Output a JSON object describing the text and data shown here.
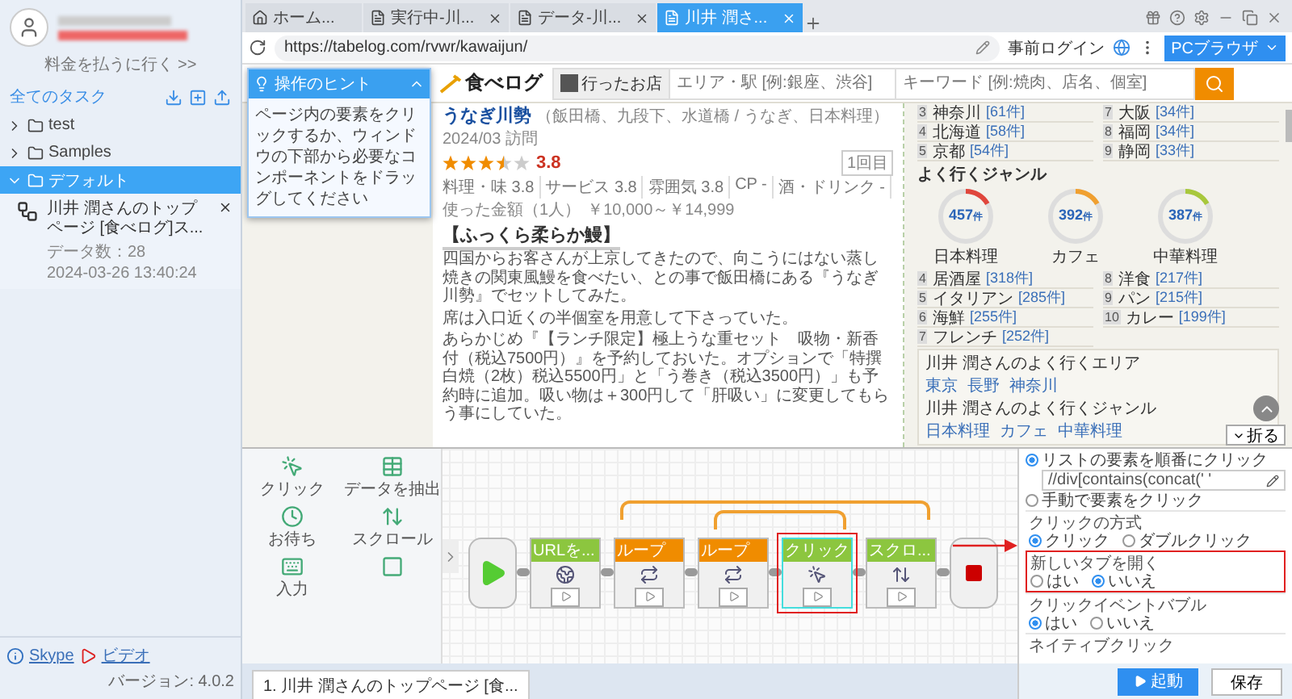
{
  "sidebar": {
    "billing_link": "料金を払うに行く >>",
    "tasks_title": "全てのタスク",
    "folders": [
      {
        "name": "test",
        "expanded": false,
        "selected": false
      },
      {
        "name": "Samples",
        "expanded": false,
        "selected": false
      },
      {
        "name": "デフォルト",
        "expanded": true,
        "selected": true,
        "tasks": [
          {
            "title": "川井 潤さんのトップページ [食べログ]ス...",
            "data_count": "データ数：28",
            "date": "2024-03-26 13:40:24"
          }
        ]
      }
    ],
    "footer": {
      "skype": "Skype",
      "video": "ビデオ",
      "version": "バージョン: 4.0.2"
    }
  },
  "browser": {
    "tabs": [
      {
        "label": "ホーム...",
        "kind": "home",
        "selected": false
      },
      {
        "label": "実行中-川...",
        "kind": "page",
        "selected": false
      },
      {
        "label": "データ-川...",
        "kind": "page",
        "selected": false
      },
      {
        "label": "川井 潤さ...",
        "kind": "page",
        "selected": true
      }
    ],
    "url": "https://tabelog.com/rvwr/kawaijun/",
    "login": "事前ログイン",
    "mode_button": "PCブラウザ"
  },
  "hint": {
    "title": "操作のヒント",
    "text": "ページ内の要素をクリックするか、ウィンドウの下部から必要なコンポーネントをドラッグしてください"
  },
  "page": {
    "logo": "食べログ",
    "went_label": "行ったお店",
    "area_placeholder": "エリア・駅 [例:銀座、渋谷]",
    "keyword_placeholder": "キーワード [例:焼肉、店名、個室]",
    "review": {
      "restaurant": "うなぎ川勢",
      "restaurant_info": "（飯田橋、九段下、水道橋 / うなぎ、日本料理）",
      "visit": "2024/03 訪問",
      "stars": 3.5,
      "score": "3.8",
      "subscores": [
        {
          "label": "料理・味",
          "value": "3.8"
        },
        {
          "label": "サービス",
          "value": "3.8"
        },
        {
          "label": "雰囲気",
          "value": "3.8"
        },
        {
          "label": "CP",
          "value": "-"
        },
        {
          "label": "酒・ドリンク",
          "value": "-"
        }
      ],
      "visit_count": "1回目",
      "price_label": "使った金額（1人）",
      "price": "￥10,000～￥14,999",
      "title": "【ふっくら柔らか鰻】",
      "paragraphs": [
        "四国からお客さんが上京してきたので、向こうにはない蒸し焼きの関東風鰻を食べたい、との事で飯田橋にある『うなぎ川勢』でセットしてみた。",
        "席は入口近くの半個室を用意して下さっていた。",
        "あらかじめ『【ランチ限定】極上うな重セット　吸物・新香付（税込7500円）』を予約しておいた。オプションで「特撰白焼（2枚）税込5500円」と「う巻き（税込3500円）」も予約時に追加。吸い物は＋300円して「肝吸い」に変更してもらう事にしていた。"
      ]
    },
    "areas": [
      {
        "rank": "3",
        "name": "神奈川",
        "count": "[61件]"
      },
      {
        "rank": "7",
        "name": "大阪",
        "count": "[34件]"
      },
      {
        "rank": "4",
        "name": "北海道",
        "count": "[58件]"
      },
      {
        "rank": "8",
        "name": "福岡",
        "count": "[34件]"
      },
      {
        "rank": "5",
        "name": "京都",
        "count": "[54件]"
      },
      {
        "rank": "9",
        "name": "静岡",
        "count": "[33件]"
      }
    ],
    "genre_title": "よく行くジャンル",
    "top_genres": [
      {
        "count": "457$_{件}$",
        "name": "日本料理",
        "color": "#e0463c"
      },
      {
        "count": "392$_{件}$",
        "name": "カフェ",
        "color": "#f0a030"
      },
      {
        "count": "387$_{件}$",
        "name": "中華料理",
        "color": "#a8c83c"
      }
    ],
    "genres": [
      {
        "rank": "4",
        "name": "居酒屋",
        "count": "[318件]"
      },
      {
        "rank": "5",
        "name": "イタリアン",
        "count": "[285件]"
      },
      {
        "rank": "6",
        "name": "海鮮",
        "count": "[255件]"
      },
      {
        "rank": "7",
        "name": "フレンチ",
        "count": "[252件]"
      },
      {
        "rank": "8",
        "name": "洋食",
        "count": "[217件]"
      },
      {
        "rank": "9",
        "name": "パン",
        "count": "[215件]"
      },
      {
        "rank": "10",
        "name": "カレー",
        "count": "[199件]"
      }
    ],
    "frequent": [
      {
        "title": "川井 潤さんのよく行くエリア",
        "tags": [
          "東京",
          "長野",
          "神奈川"
        ]
      },
      {
        "title": "川井 潤さんのよく行くジャンル",
        "tags": [
          "日本料理",
          "カフェ",
          "中華料理"
        ]
      }
    ]
  },
  "collapse_button": "折る",
  "editor": {
    "palette": [
      {
        "label": "クリック",
        "kind": "click"
      },
      {
        "label": "データを抽出",
        "kind": "extract"
      },
      {
        "label": "お待ち",
        "kind": "wait"
      },
      {
        "label": "スクロール",
        "kind": "scroll"
      },
      {
        "label": "入力",
        "kind": "input"
      }
    ],
    "nodes": [
      {
        "kind": "start"
      },
      {
        "kind": "action",
        "label": "URLを...",
        "selected": false
      },
      {
        "kind": "loop",
        "label": "ループ",
        "selected": false
      },
      {
        "kind": "loop",
        "label": "ループ",
        "selected": false
      },
      {
        "kind": "action",
        "label": "クリック",
        "selected": true
      },
      {
        "kind": "action",
        "label": "スクロ...",
        "selected": false
      },
      {
        "kind": "end"
      }
    ],
    "task_tab": "1. 川井 潤さんのトップページ [食..."
  },
  "settings": {
    "list_option": {
      "label": "リストの要素を順番にクリック",
      "selected": true
    },
    "xpath": "//div[contains(concat(' '",
    "manual_option": {
      "label": "手動で要素をクリック",
      "selected": false
    },
    "sections": [
      {
        "title": "クリックの方式",
        "highlighted": false,
        "options": [
          {
            "label": "クリック",
            "selected": true
          },
          {
            "label": "ダブルクリック",
            "selected": false
          }
        ]
      },
      {
        "title": "新しいタブを開く",
        "highlighted": true,
        "options": [
          {
            "label": "はい",
            "selected": false
          },
          {
            "label": "いいえ",
            "selected": true
          }
        ]
      },
      {
        "title": "クリックイベントバブル",
        "highlighted": false,
        "options": [
          {
            "label": "はい",
            "selected": true
          },
          {
            "label": "いいえ",
            "selected": false
          }
        ]
      },
      {
        "title": "ネイティブクリック",
        "highlighted": false
      }
    ]
  },
  "actions": {
    "run": "起動",
    "save": "保存"
  }
}
